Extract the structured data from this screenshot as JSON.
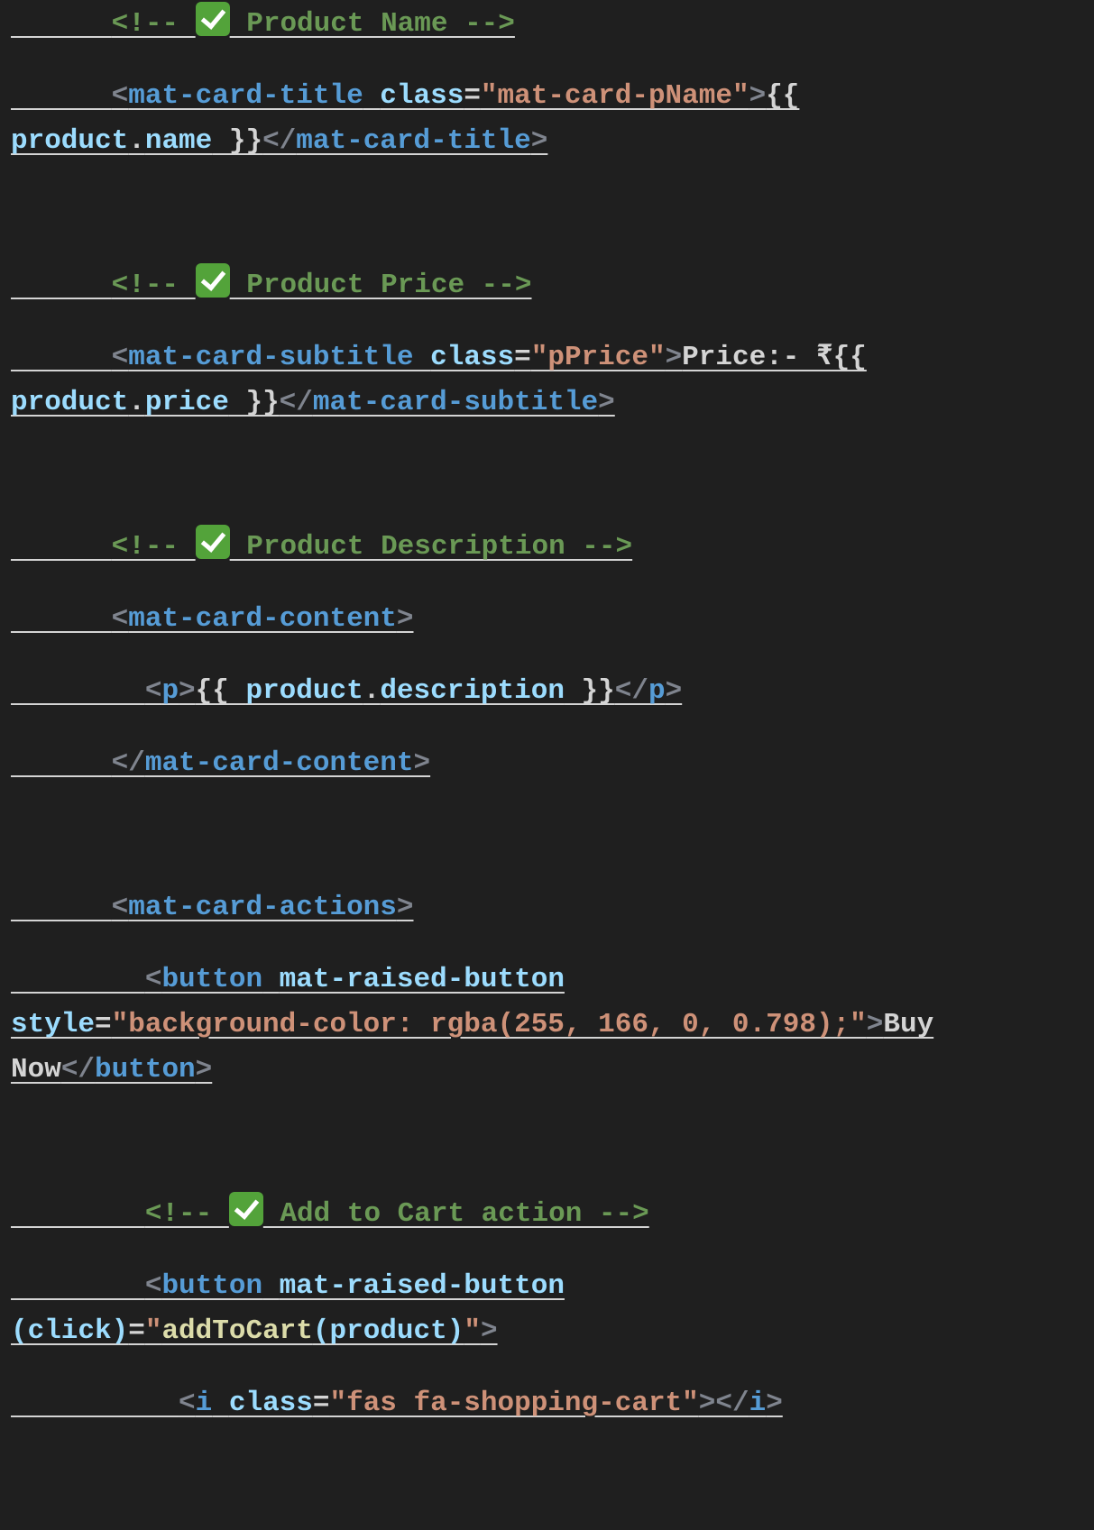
{
  "editor": {
    "theme_colors": {
      "background": "#1f1f1f",
      "bracket": "#7f848e",
      "tag": "#569cd6",
      "attribute": "#9cdcfe",
      "string": "#ce9178",
      "comment": "#6a9955",
      "text": "#d4d4d4",
      "function": "#dcdcaa",
      "checkmark": "#53a33a"
    },
    "lines": [
      {
        "indent": "      ",
        "tokens": [
          {
            "c": "cm",
            "t": "<!-- "
          },
          {
            "c": "icon",
            "icon": "check-mark-icon"
          },
          {
            "c": "cm",
            "t": " Product Name -->"
          }
        ]
      },
      {
        "indent": "      ",
        "tokens": [
          {
            "c": "t",
            "t": "<"
          },
          {
            "c": "tg",
            "t": "mat-card-title"
          },
          {
            "c": "tx",
            "t": " "
          },
          {
            "c": "at",
            "t": "class"
          },
          {
            "c": "tx",
            "t": "="
          },
          {
            "c": "st",
            "t": "\"mat-card-pName\""
          },
          {
            "c": "t",
            "t": ">"
          },
          {
            "c": "tx",
            "t": "{{"
          }
        ]
      },
      {
        "indent": "",
        "tokens": [
          {
            "c": "at",
            "t": "product"
          },
          {
            "c": "tx",
            "t": "."
          },
          {
            "c": "at",
            "t": "name"
          },
          {
            "c": "tx",
            "t": " }}"
          },
          {
            "c": "t",
            "t": "</"
          },
          {
            "c": "tg",
            "t": "mat-card-title"
          },
          {
            "c": "t",
            "t": ">"
          }
        ]
      },
      {
        "indent": "      ",
        "tokens": [
          {
            "c": "cm",
            "t": "<!-- "
          },
          {
            "c": "icon",
            "icon": "check-mark-icon"
          },
          {
            "c": "cm",
            "t": " Product Price -->"
          }
        ]
      },
      {
        "indent": "      ",
        "tokens": [
          {
            "c": "t",
            "t": "<"
          },
          {
            "c": "tg",
            "t": "mat-card-subtitle"
          },
          {
            "c": "tx",
            "t": " "
          },
          {
            "c": "at",
            "t": "class"
          },
          {
            "c": "tx",
            "t": "="
          },
          {
            "c": "st",
            "t": "\"pPrice\""
          },
          {
            "c": "t",
            "t": ">"
          },
          {
            "c": "tx",
            "t": "Price:- ₹{{"
          }
        ]
      },
      {
        "indent": "",
        "tokens": [
          {
            "c": "at",
            "t": "product"
          },
          {
            "c": "tx",
            "t": "."
          },
          {
            "c": "at",
            "t": "price"
          },
          {
            "c": "tx",
            "t": " }}"
          },
          {
            "c": "t",
            "t": "</"
          },
          {
            "c": "tg",
            "t": "mat-card-subtitle"
          },
          {
            "c": "t",
            "t": ">"
          }
        ]
      },
      {
        "indent": "      ",
        "tokens": [
          {
            "c": "cm",
            "t": "<!-- "
          },
          {
            "c": "icon",
            "icon": "check-mark-icon"
          },
          {
            "c": "cm",
            "t": " Product Description -->"
          }
        ]
      },
      {
        "indent": "      ",
        "tokens": [
          {
            "c": "t",
            "t": "<"
          },
          {
            "c": "tg",
            "t": "mat-card-content"
          },
          {
            "c": "t",
            "t": ">"
          }
        ]
      },
      {
        "indent": "        ",
        "tokens": [
          {
            "c": "t",
            "t": "<"
          },
          {
            "c": "tg",
            "t": "p"
          },
          {
            "c": "t",
            "t": ">"
          },
          {
            "c": "tx",
            "t": "{{ "
          },
          {
            "c": "at",
            "t": "product"
          },
          {
            "c": "tx",
            "t": "."
          },
          {
            "c": "at",
            "t": "description"
          },
          {
            "c": "tx",
            "t": " }}"
          },
          {
            "c": "t",
            "t": "</"
          },
          {
            "c": "tg",
            "t": "p"
          },
          {
            "c": "t",
            "t": ">"
          }
        ]
      },
      {
        "indent": "      ",
        "tokens": [
          {
            "c": "t",
            "t": "</"
          },
          {
            "c": "tg",
            "t": "mat-card-content"
          },
          {
            "c": "t",
            "t": ">"
          }
        ]
      },
      {
        "indent": "      ",
        "tokens": [
          {
            "c": "t",
            "t": "<"
          },
          {
            "c": "tg",
            "t": "mat-card-actions"
          },
          {
            "c": "t",
            "t": ">"
          }
        ]
      },
      {
        "indent": "        ",
        "tokens": [
          {
            "c": "t",
            "t": "<"
          },
          {
            "c": "tg",
            "t": "button"
          },
          {
            "c": "tx",
            "t": " "
          },
          {
            "c": "at",
            "t": "mat-raised-button"
          }
        ]
      },
      {
        "indent": "",
        "tokens": [
          {
            "c": "at",
            "t": "style"
          },
          {
            "c": "tx",
            "t": "="
          },
          {
            "c": "st",
            "t": "\"background-color: rgba(255, 166, 0, 0.798);\""
          },
          {
            "c": "t",
            "t": ">"
          },
          {
            "c": "tx",
            "t": "Buy"
          }
        ]
      },
      {
        "indent": "",
        "tokens": [
          {
            "c": "tx",
            "t": "Now"
          },
          {
            "c": "t",
            "t": "</"
          },
          {
            "c": "tg",
            "t": "button"
          },
          {
            "c": "t",
            "t": ">"
          }
        ]
      },
      {
        "indent": "        ",
        "tokens": [
          {
            "c": "cm",
            "t": "<!-- "
          },
          {
            "c": "icon",
            "icon": "check-mark-icon"
          },
          {
            "c": "cm",
            "t": " Add to Cart action -->"
          }
        ]
      },
      {
        "indent": "        ",
        "tokens": [
          {
            "c": "t",
            "t": "<"
          },
          {
            "c": "tg",
            "t": "button"
          },
          {
            "c": "tx",
            "t": " "
          },
          {
            "c": "at",
            "t": "mat-raised-button"
          }
        ]
      },
      {
        "indent": "",
        "tokens": [
          {
            "c": "at",
            "t": "(click)"
          },
          {
            "c": "tx",
            "t": "="
          },
          {
            "c": "st",
            "t": "\""
          },
          {
            "c": "fn",
            "t": "addToCart"
          },
          {
            "c": "at",
            "t": "(product)"
          },
          {
            "c": "st",
            "t": "\""
          },
          {
            "c": "t",
            "t": ">"
          }
        ]
      },
      {
        "indent": "          ",
        "tokens": [
          {
            "c": "t",
            "t": "<"
          },
          {
            "c": "tg",
            "t": "i"
          },
          {
            "c": "tx",
            "t": " "
          },
          {
            "c": "at",
            "t": "class"
          },
          {
            "c": "tx",
            "t": "="
          },
          {
            "c": "st",
            "t": "\"fas fa-shopping-cart\""
          },
          {
            "c": "t",
            "t": "></"
          },
          {
            "c": "tg",
            "t": "i"
          },
          {
            "c": "t",
            "t": ">"
          }
        ]
      }
    ]
  }
}
